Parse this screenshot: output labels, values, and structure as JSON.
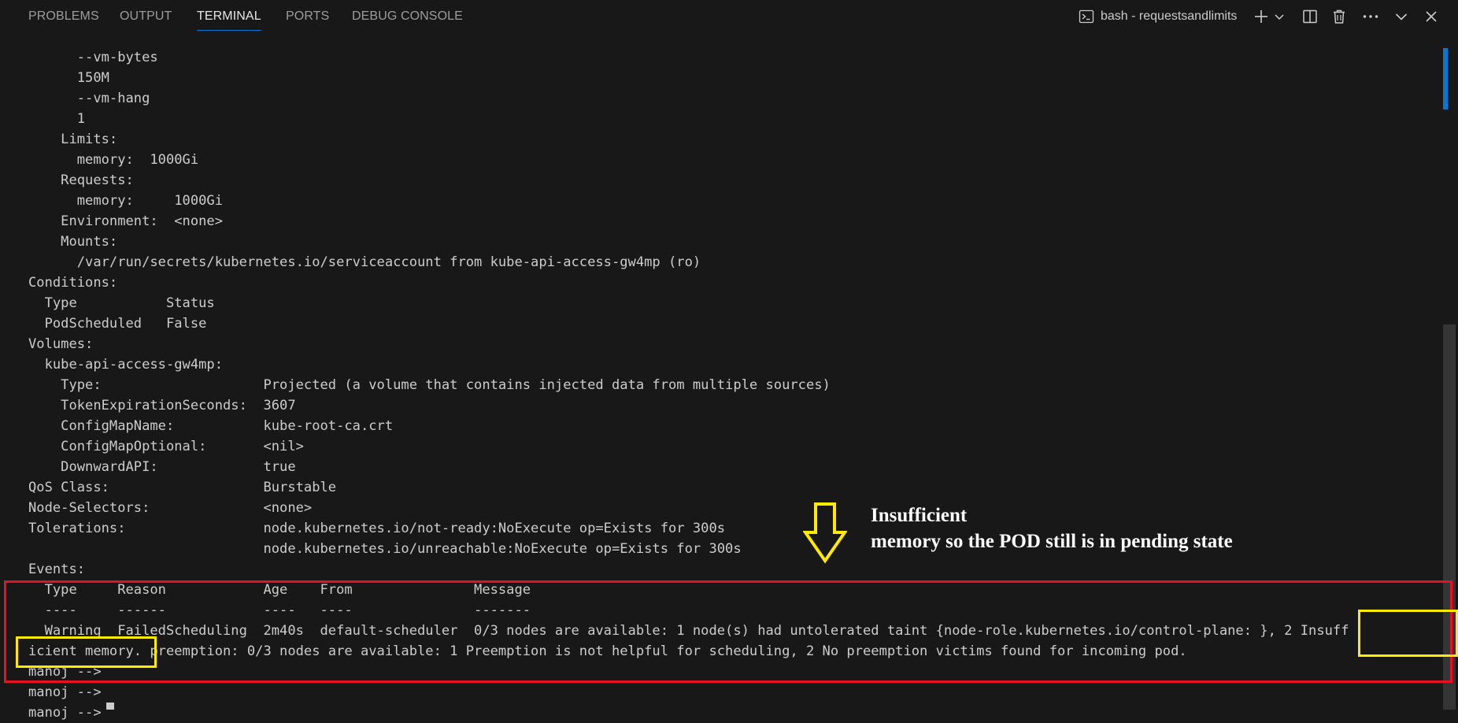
{
  "tabs": [
    {
      "label": "PROBLEMS",
      "active": false
    },
    {
      "label": "OUTPUT",
      "active": false
    },
    {
      "label": "TERMINAL",
      "active": true
    },
    {
      "label": "PORTS",
      "active": false
    },
    {
      "label": "DEBUG CONSOLE",
      "active": false
    }
  ],
  "terminal_actions": {
    "session_label": "bash - requestsandlimits",
    "icons": [
      "terminal-icon",
      "plus-icon",
      "chevron-down-icon",
      "split-icon",
      "trash-icon",
      "ellipsis-icon",
      "chevron-down-icon",
      "close-icon"
    ]
  },
  "terminal_lines": [
    "      --vm-bytes",
    "      150M",
    "      --vm-hang",
    "      1",
    "    Limits:",
    "      memory:  1000Gi",
    "    Requests:",
    "      memory:     1000Gi",
    "    Environment:  <none>",
    "    Mounts:",
    "      /var/run/secrets/kubernetes.io/serviceaccount from kube-api-access-gw4mp (ro)",
    "Conditions:",
    "  Type           Status",
    "  PodScheduled   False",
    "Volumes:",
    "  kube-api-access-gw4mp:",
    "    Type:                    Projected (a volume that contains injected data from multiple sources)",
    "    TokenExpirationSeconds:  3607",
    "    ConfigMapName:           kube-root-ca.crt",
    "    ConfigMapOptional:       <nil>",
    "    DownwardAPI:             true",
    "QoS Class:                   Burstable",
    "Node-Selectors:              <none>",
    "Tolerations:                 node.kubernetes.io/not-ready:NoExecute op=Exists for 300s",
    "                             node.kubernetes.io/unreachable:NoExecute op=Exists for 300s",
    "Events:",
    "  Type     Reason            Age    From               Message",
    "  ----     ------            ----   ----               -------",
    "  Warning  FailedScheduling  2m40s  default-scheduler  0/3 nodes are available: 1 node(s) had untolerated taint {node-role.kubernetes.io/control-plane: }, 2 Insuff",
    "icient memory. preemption: 0/3 nodes are available: 1 Preemption is not helpful for scheduling, 2 No preemption victims found for incoming pod.",
    "manoj -->",
    "manoj -->",
    "manoj -->"
  ],
  "annotation": {
    "line1": "Insufficient",
    "line2": "memory so the POD still is in pending state"
  },
  "colors": {
    "background": "#181818",
    "text": "#cccccc",
    "accent": "#0078d4",
    "annotation_red": "#e81123",
    "annotation_yellow": "#ffea00"
  }
}
